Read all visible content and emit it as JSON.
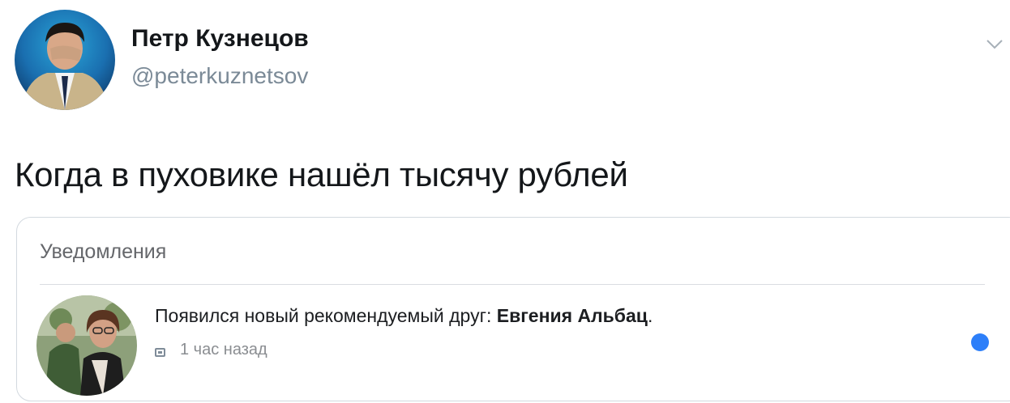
{
  "tweet": {
    "author_name": "Петр Кузнецов",
    "author_handle": "@peterkuznetsov",
    "text": "Когда в пуховике нашёл тысячу рублей"
  },
  "notification_card": {
    "header": "Уведомления",
    "notification": {
      "text_prefix": "Появился новый рекомендуемый друг: ",
      "friend_name": "Евгения Альбац",
      "text_suffix": ".",
      "time": "1 час назад",
      "unread": true
    }
  },
  "colors": {
    "unread_dot": "#2d7ff9",
    "handle": "#7b8a97"
  },
  "icons": {
    "menu": "chevron-down-icon",
    "notification_type": "friend-suggestion-icon",
    "unread": "unread-dot-icon"
  }
}
